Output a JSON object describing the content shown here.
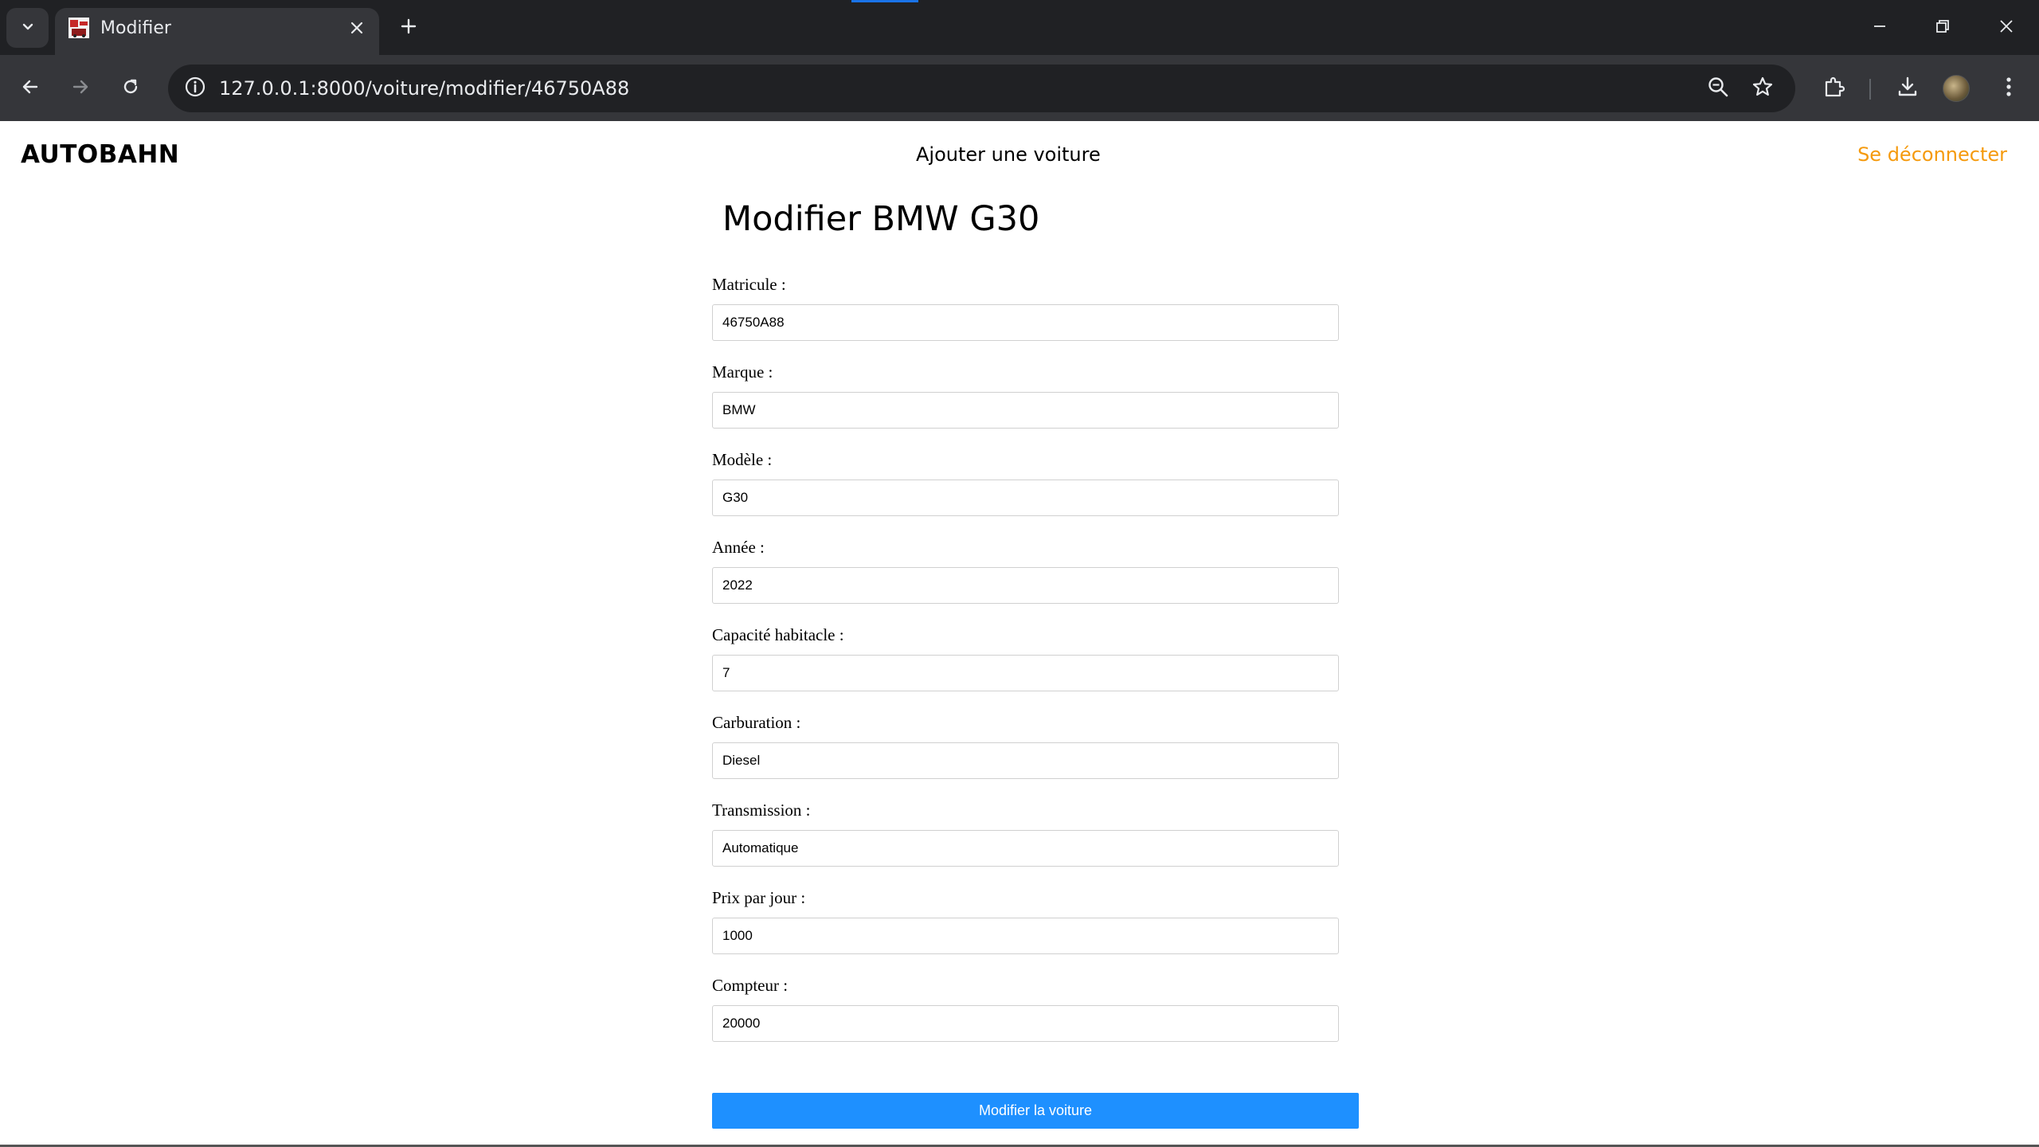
{
  "browser": {
    "tab": {
      "title": "Modifier"
    },
    "address_bar": {
      "url": "127.0.0.1:8000/voiture/modifier/46750A88"
    }
  },
  "header": {
    "brand": "AUTOBAHN",
    "add_car_link": "Ajouter une voiture",
    "logout_link": "Se déconnecter",
    "accent_color": "#f59a0d"
  },
  "form": {
    "title": "Modifier BMW G30",
    "fields": [
      {
        "label": "Matricule :",
        "value": "46750A88"
      },
      {
        "label": "Marque :",
        "value": "BMW"
      },
      {
        "label": "Modèle :",
        "value": "G30"
      },
      {
        "label": "Année :",
        "value": "2022"
      },
      {
        "label": "Capacité habitacle :",
        "value": "7"
      },
      {
        "label": "Carburation :",
        "value": "Diesel"
      },
      {
        "label": "Transmission :",
        "value": "Automatique"
      },
      {
        "label": "Prix par jour :",
        "value": "1000"
      },
      {
        "label": "Compteur :",
        "value": "20000"
      }
    ],
    "submit_label": "Modifier la voiture",
    "submit_color": "#1e90ff"
  }
}
